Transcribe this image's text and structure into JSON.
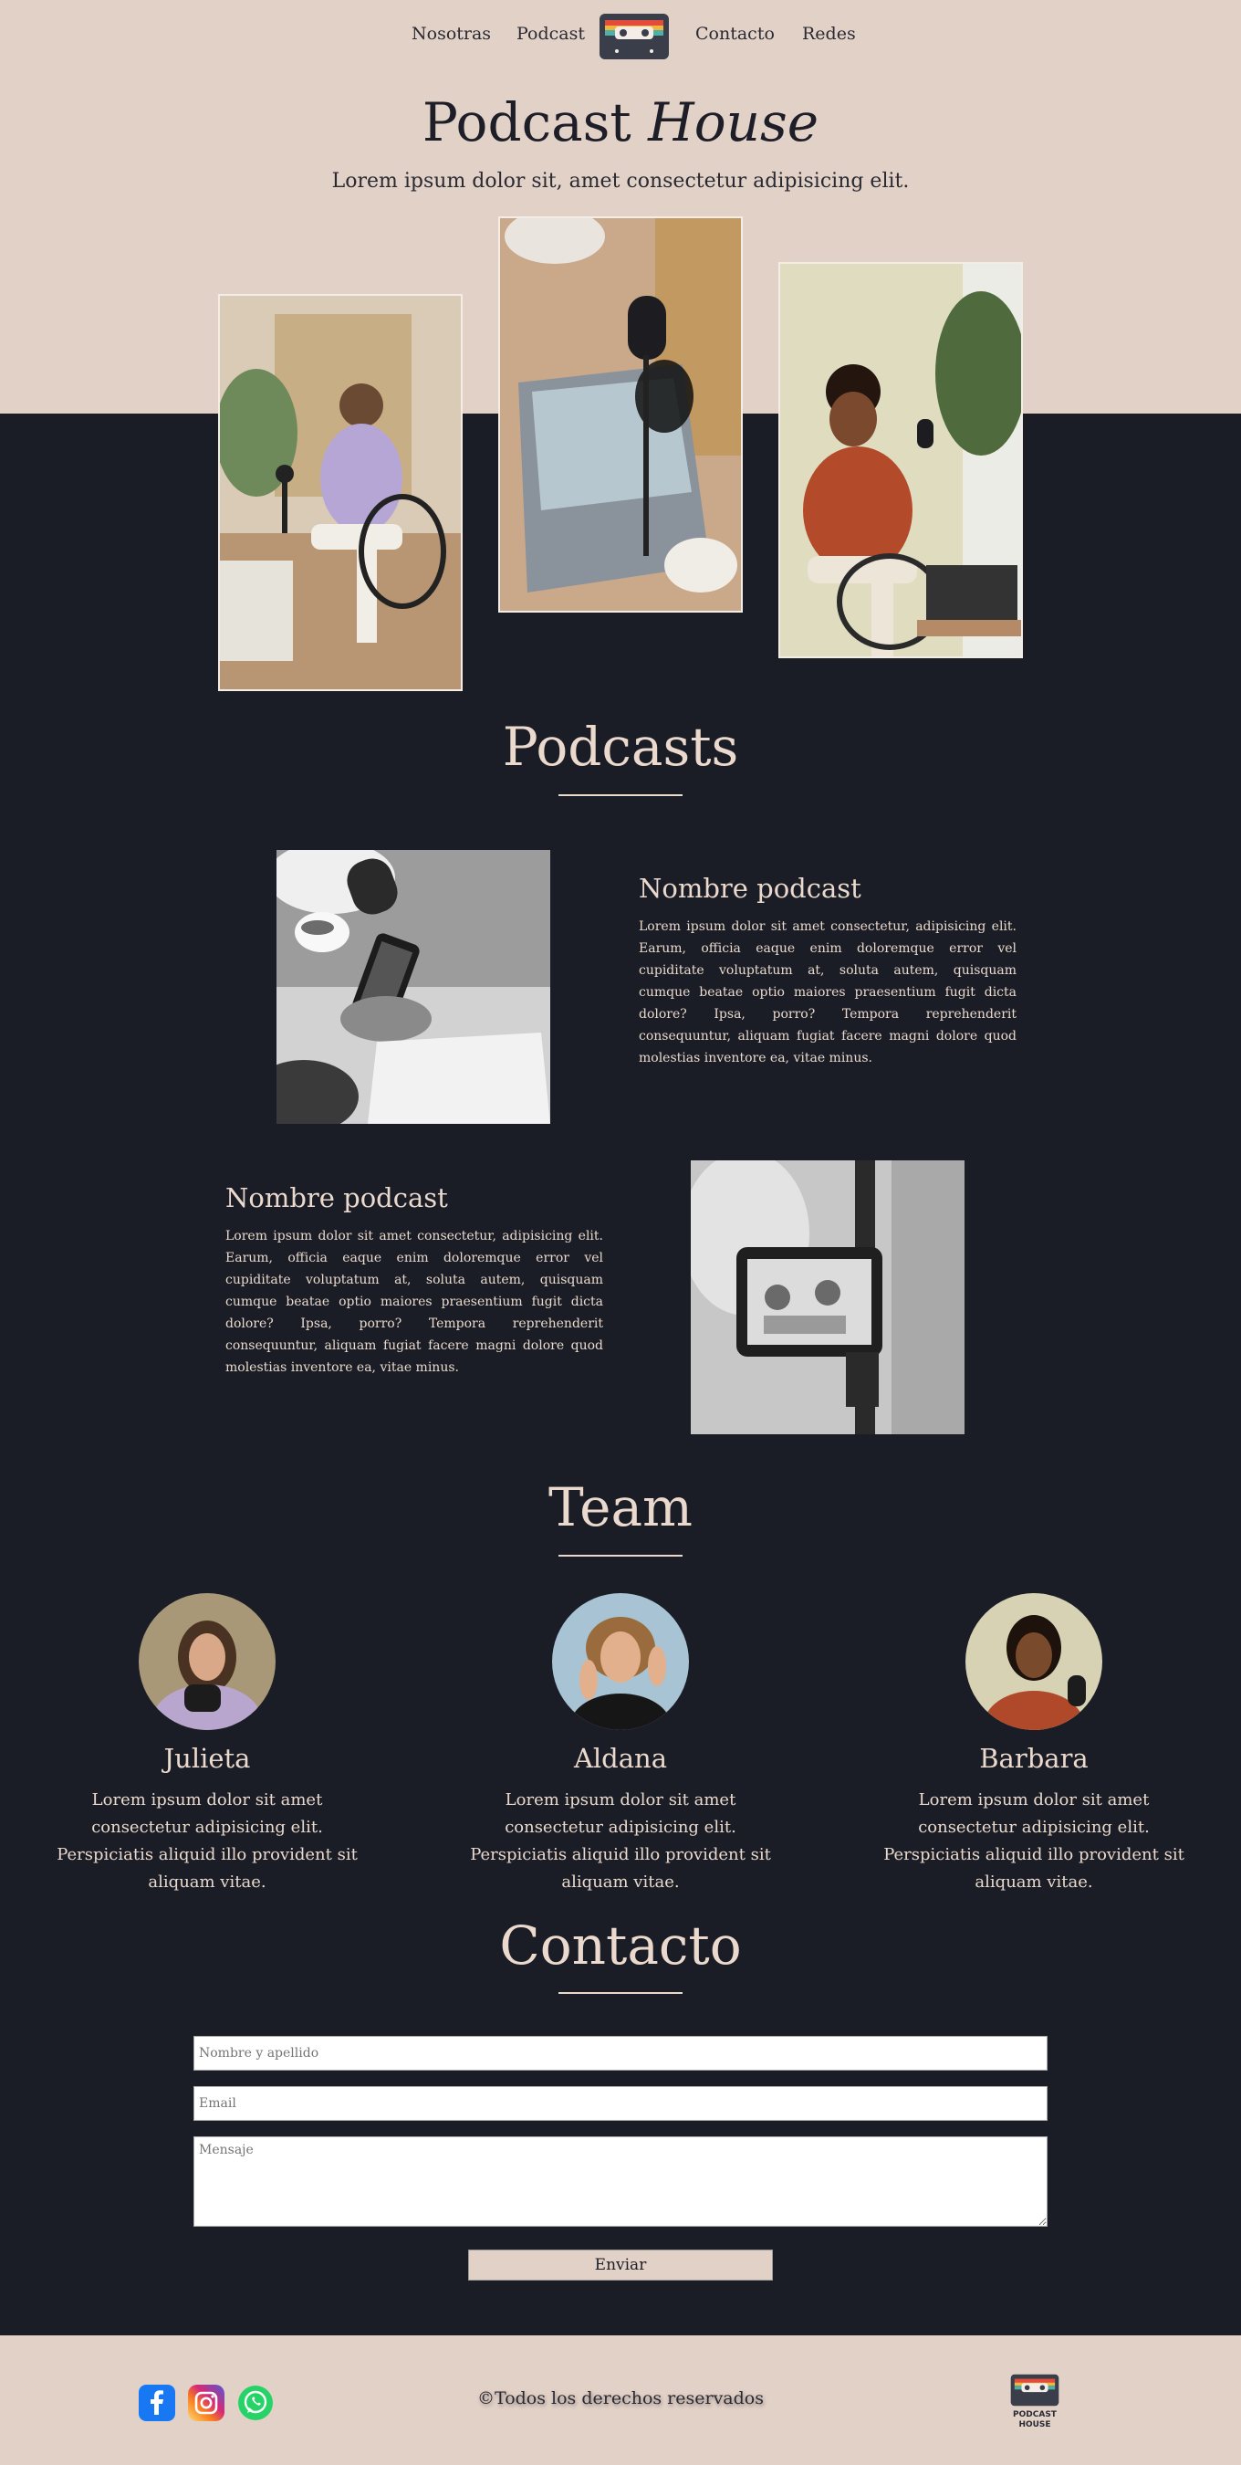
{
  "nav": {
    "items": [
      "Nosotras",
      "Podcast",
      "Contacto",
      "Redes"
    ]
  },
  "hero": {
    "title_main": "Podcast",
    "title_script": "House",
    "subtitle": "Lorem ipsum dolor sit, amet consectetur adipisicing elit."
  },
  "podcasts": {
    "heading": "Podcasts",
    "items": [
      {
        "title": "Nombre podcast",
        "text": "Lorem ipsum dolor sit amet consectetur, adipisicing elit. Earum, officia eaque enim doloremque error vel cupiditate voluptatum at, soluta autem, quisquam cumque beatae optio maiores praesentium fugit dicta dolore? Ipsa, porro? Tempora reprehenderit consequuntur, aliquam fugiat facere magni dolore quod molestias inventore ea, vitae minus."
      },
      {
        "title": "Nombre podcast",
        "text": "Lorem ipsum dolor sit amet consectetur, adipisicing elit. Earum, officia eaque enim doloremque error vel cupiditate voluptatum at, soluta autem, quisquam cumque beatae optio maiores praesentium fugit dicta dolore? Ipsa, porro? Tempora reprehenderit consequuntur, aliquam fugiat facere magni dolore quod molestias inventore ea, vitae minus."
      }
    ]
  },
  "team": {
    "heading": "Team",
    "members": [
      {
        "name": "Julieta",
        "text": "Lorem ipsum dolor sit amet consectetur adipisicing elit. Perspiciatis aliquid illo provident sit aliquam vitae."
      },
      {
        "name": "Aldana",
        "text": "Lorem ipsum dolor sit amet consectetur adipisicing elit. Perspiciatis aliquid illo provident sit aliquam vitae."
      },
      {
        "name": "Barbara",
        "text": "Lorem ipsum dolor sit amet consectetur adipisicing elit. Perspiciatis aliquid illo provident sit aliquam vitae."
      }
    ]
  },
  "contact": {
    "heading": "Contacto",
    "name_placeholder": "Nombre y apellido",
    "email_placeholder": "Email",
    "message_placeholder": "Mensaje",
    "send_label": "Enviar"
  },
  "footer": {
    "copyright": "©Todos los derechos reservados",
    "logo_line1": "PODCAST",
    "logo_line2": "HOUSE",
    "social_icons": [
      "facebook-icon",
      "instagram-icon",
      "whatsapp-icon"
    ]
  },
  "colors": {
    "beige": "#e2d1c7",
    "navy": "#1a1d26",
    "text_light": "#ead9cc"
  }
}
